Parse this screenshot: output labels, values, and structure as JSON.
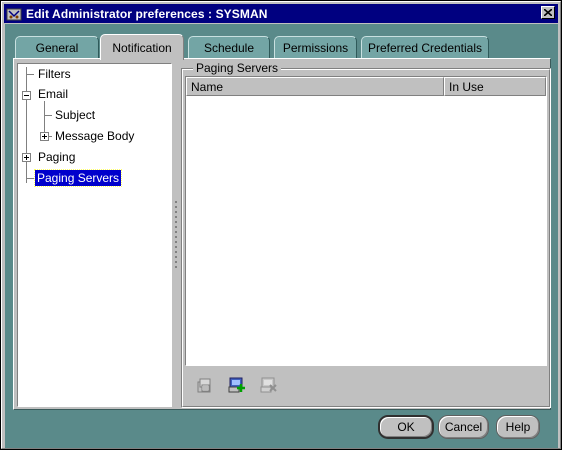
{
  "window": {
    "title": "Edit Administrator preferences : SYSMAN",
    "icon": "app-tool-icon",
    "close_icon": "close-icon"
  },
  "tabs": [
    {
      "label": "General",
      "active": false
    },
    {
      "label": "Notification",
      "active": true
    },
    {
      "label": "Schedule",
      "active": false
    },
    {
      "label": "Permissions",
      "active": false
    },
    {
      "label": "Preferred Credentials",
      "active": false
    }
  ],
  "tree": {
    "nodes": [
      {
        "label": "Filters",
        "level": 0
      },
      {
        "label": "Email",
        "level": 0,
        "expanded": true
      },
      {
        "label": "Subject",
        "level": 1
      },
      {
        "label": "Message Body",
        "level": 1,
        "expanded": false
      },
      {
        "label": "Paging",
        "level": 0,
        "expanded": false
      },
      {
        "label": "Paging Servers",
        "level": 0,
        "selected": true
      }
    ]
  },
  "group": {
    "title": "Paging Servers",
    "columns": [
      "Name",
      "In Use"
    ],
    "rows": []
  },
  "toolbar": {
    "buttons": [
      {
        "icon": "properties-icon",
        "enabled": false
      },
      {
        "icon": "add-server-icon",
        "enabled": true
      },
      {
        "icon": "remove-server-icon",
        "enabled": false
      }
    ]
  },
  "buttons": {
    "ok": "OK",
    "cancel": "Cancel",
    "help": "Help"
  },
  "colors": {
    "titlebar": "#000080",
    "tab_background": "#5a8a8a",
    "selection": "#0000cc"
  }
}
